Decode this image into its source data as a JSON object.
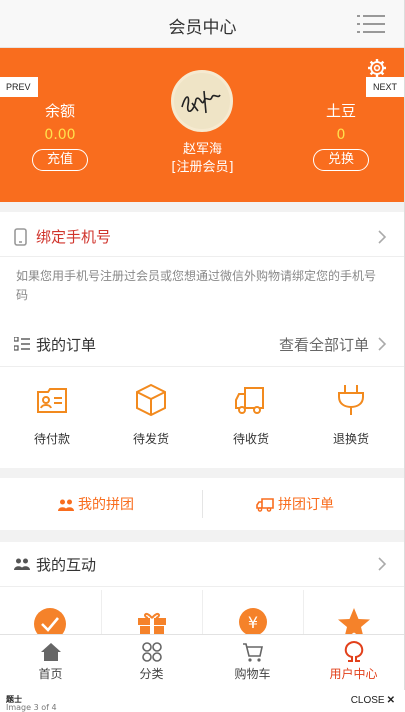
{
  "header": {
    "title": "会员中心"
  },
  "profile": {
    "name": "赵军海",
    "level": "[注册会员]",
    "balance": {
      "label": "余额",
      "value": "0.00",
      "button": "充值"
    },
    "potato": {
      "label": "土豆",
      "value": "0",
      "button": "兑换"
    }
  },
  "gallery": {
    "prev": "PREV",
    "next": "NEXT",
    "caption_title": "题士",
    "caption_count": "Image 3 of 4",
    "close": "CLOSE"
  },
  "bind_phone": {
    "title": "绑定手机号",
    "description": "如果您用手机号注册过会员或您想通过微信外购物请绑定您的手机号码"
  },
  "orders": {
    "title": "我的订单",
    "view_all": "查看全部订单",
    "items": [
      {
        "label": "待付款",
        "icon": "wallet-icon"
      },
      {
        "label": "待发货",
        "icon": "box-icon"
      },
      {
        "label": "待收货",
        "icon": "truck-icon"
      },
      {
        "label": "退换货",
        "icon": "plug-icon"
      }
    ]
  },
  "groups": {
    "my_group": "我的拼团",
    "group_orders": "拼团订单"
  },
  "interaction": {
    "title": "我的互动"
  },
  "tabbar": [
    {
      "label": "首页",
      "icon": "home-icon"
    },
    {
      "label": "分类",
      "icon": "category-icon"
    },
    {
      "label": "购物车",
      "icon": "cart-icon"
    },
    {
      "label": "用户中心",
      "icon": "user-icon"
    }
  ],
  "colors": {
    "accent": "#f96d1e",
    "danger": "#d0342c",
    "active_tab": "#e2401b",
    "value_yellow": "#ffe14d"
  }
}
